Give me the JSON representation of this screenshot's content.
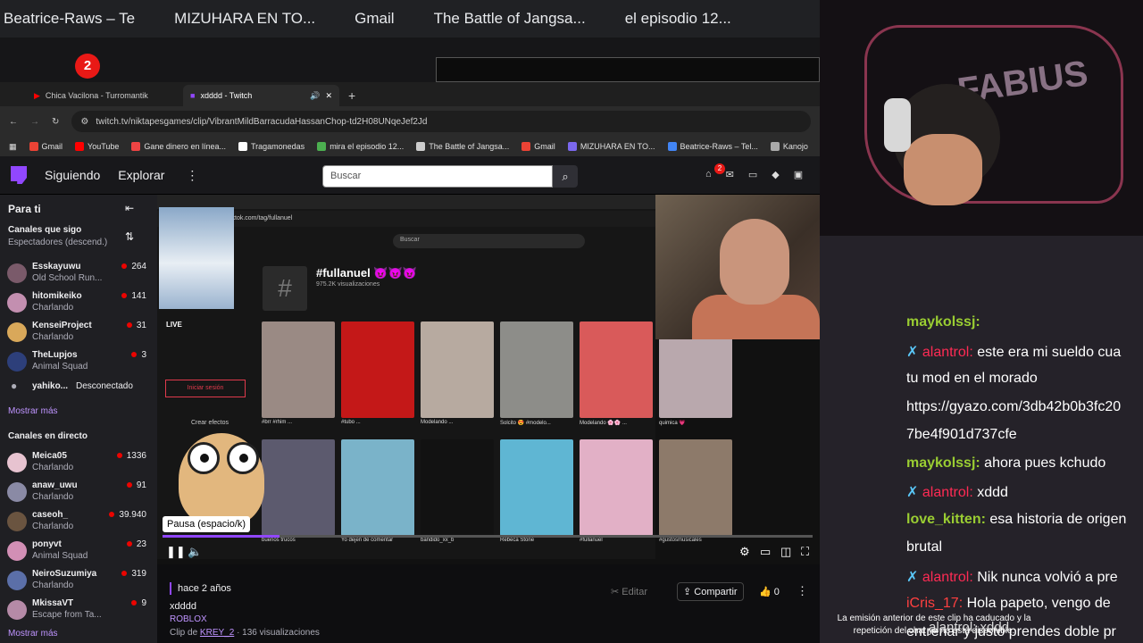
{
  "outer_bookmarks": [
    "Beatrice-Raws – Te",
    "MIZUHARA EN TO...",
    "Gmail",
    "The Battle of Jangsa...",
    "el episodio 12..."
  ],
  "outer_badge": "2",
  "browser": {
    "tabs": [
      "Chica Vacilona - Turromantik",
      "xdddd - Twitch"
    ],
    "url": "twitch.tv/niktapesgames/clip/VibrantMildBarracudaHassanChop-td2H08UNqeJef2Jd",
    "bookmarks": [
      "Gmail",
      "YouTube",
      "Gane dinero en línea...",
      "Tragamonedas",
      "mira el episodio 12...",
      "The Battle of Jangsa...",
      "Gmail",
      "MIZUHARA EN TO...",
      "Beatrice-Raws – Tel...",
      "Kanojo"
    ]
  },
  "twitch_nav": {
    "following": "Siguiendo",
    "explore": "Explorar",
    "search_placeholder": "Buscar",
    "notif_count": "2"
  },
  "sidebar": {
    "for_you": "Para ti",
    "followed_title": "Canales que sigo",
    "followed_sub": "Espectadores (descend.)",
    "followed": [
      {
        "name": "Esskayuwu",
        "game": "Old School Run...",
        "viewers": "264",
        "color": "#7a5a6a"
      },
      {
        "name": "hitomikeiko",
        "game": "Charlando",
        "viewers": "141",
        "color": "#c38fb0"
      },
      {
        "name": "KenseiProject",
        "game": "Charlando",
        "viewers": "31",
        "color": "#d9a85a"
      },
      {
        "name": "TheLupjos",
        "game": "Animal Squad",
        "viewers": "3",
        "color": "#2d3f7a"
      }
    ],
    "offline": {
      "name": "yahiko...",
      "status": "Desconectado"
    },
    "show_more": "Mostrar más",
    "live_title": "Canales en directo",
    "live": [
      {
        "name": "Meica05",
        "game": "Charlando",
        "viewers": "1336",
        "color": "#e7c3d0"
      },
      {
        "name": "anaw_uwu",
        "game": "Charlando",
        "viewers": "91",
        "color": "#8a8aa5"
      },
      {
        "name": "caseoh_",
        "game": "Charlando",
        "viewers": "39.940",
        "color": "#6a5440"
      },
      {
        "name": "ponyvt",
        "game": "Animal Squad",
        "viewers": "23",
        "color": "#d28fb5"
      },
      {
        "name": "NeiroSuzumiya",
        "game": "Charlando",
        "viewers": "319",
        "color": "#5b6fa8"
      },
      {
        "name": "MkissaVT",
        "game": "Escape from Ta...",
        "viewers": "9",
        "color": "#b58aa7"
      }
    ],
    "show_more_2": "Mostrar más"
  },
  "video": {
    "inner_url": "tiktok.com/tag/fullanuel",
    "inner_search": "Buscar",
    "hashtag": "#fullanuel 😈😈😈",
    "hashtag_views": "975.2K visualizaciones",
    "live_label": "LIVE",
    "login_btn": "Iniciar sesión",
    "create_effects": "Crear efectos",
    "thumbs_row1": [
      {
        "cap": "#brr #rhim ...",
        "color": "#9a8a84"
      },
      {
        "cap": "#tubo ...",
        "color": "#c41818"
      },
      {
        "cap": "Modelando ...",
        "color": "#b7aaa0"
      },
      {
        "cap": "Solcito 😍 #modelo...",
        "color": "#8d8d89"
      },
      {
        "cap": "Modelando 🌸🌸 ...",
        "color": "#d95a5a"
      },
      {
        "cap": "quimica 💗",
        "color": "#b9a8ad"
      }
    ],
    "thumbs_row2": [
      {
        "cap": "buenos trucos",
        "color": "#5c5a6e"
      },
      {
        "cap": "Yo dejen de comentar",
        "color": "#7ab3c9"
      },
      {
        "cap": "bandido_xx_b",
        "color": "#121212"
      },
      {
        "cap": "Rebeca Stone",
        "color": "#5fb6d3"
      },
      {
        "cap": "#fullanuel",
        "color": "#e2b0c6"
      },
      {
        "cap": "#gustosmusicales",
        "color": "#8d7a6a"
      }
    ],
    "tooltip": "Pausa (espacio/k)",
    "progress": 0.18
  },
  "clip_info": {
    "age": "hace 2 años",
    "title": "xdddd",
    "category": "ROBLOX",
    "clip_by": "Clip de",
    "author": "KREY_2",
    "views": "· 136 visualizaciones",
    "edit": "Editar",
    "share": "Compartir",
    "likes": "0"
  },
  "overlay_cam": {
    "text": "FABIUS"
  },
  "chat": [
    {
      "user": "maykolssj:",
      "text": "",
      "mod": false
    },
    {
      "user": "alantrol:",
      "text": "este era mi sueldo cua",
      "mod": true
    },
    {
      "user": "",
      "text": "tu mod en el morado",
      "mod": false
    },
    {
      "user": "",
      "text": "https://gyazo.com/3db42b0b3fc20",
      "mod": false
    },
    {
      "user": "",
      "text": "7be4f901d737cfe",
      "mod": false
    },
    {
      "user": "maykolssj:",
      "text": "ahora pues kchudo",
      "mod": false
    },
    {
      "user": "alantrol:",
      "text": "xddd",
      "mod": true
    },
    {
      "user": "love_kitten:",
      "text": "esa historia de origen",
      "mod": false
    },
    {
      "user": "",
      "text": "brutal",
      "mod": false
    },
    {
      "user": "alantrol:",
      "text": "Nik nunca volvió a pre",
      "mod": true
    },
    {
      "user": "iCris_17:",
      "text": "Hola papeto, vengo de",
      "mod": false
    },
    {
      "user": "",
      "text": "entrenar y justo prendes doble pr",
      "mod": false
    }
  ],
  "expired": "La emisión anterior de este clip ha caducado y la repetición del chat ya no está disponible.",
  "last_line": "alantrol: xddd"
}
